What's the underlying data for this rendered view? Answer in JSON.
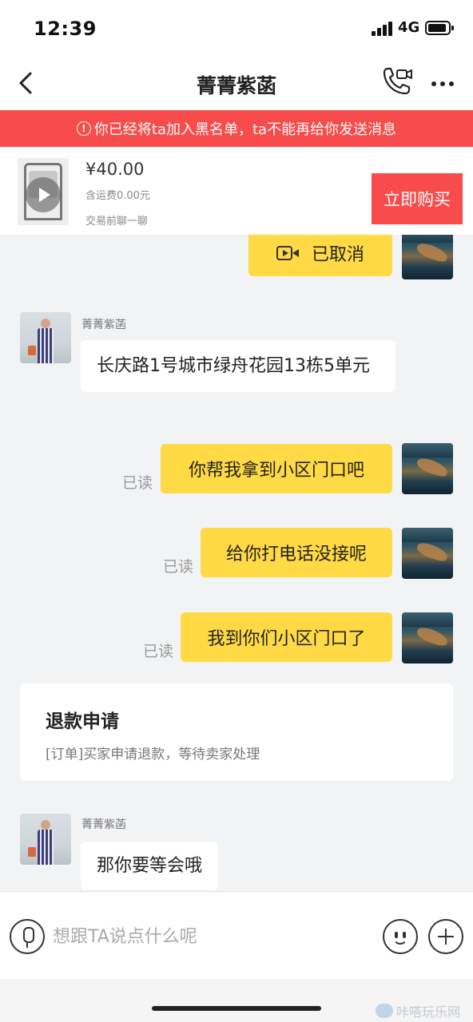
{
  "status_bar": {
    "time": "12:39",
    "network": "4G"
  },
  "nav": {
    "title": "菁菁紫菡"
  },
  "banner": {
    "warning_text": "你已经将ta加入黑名单，ta不能再给你发送消息"
  },
  "product": {
    "price": "¥40.00",
    "shipping": "含运费0.00元",
    "chat_tip": "交易前聊一聊",
    "buy_label": "立即购买"
  },
  "messages": [
    {
      "side": "right",
      "type": "video-call",
      "text": "已取消"
    },
    {
      "side": "left",
      "sender": "菁菁紫菡",
      "text": "长庆路1号城市绿舟花园13栋5单元"
    },
    {
      "side": "right",
      "status": "已读",
      "text": "你帮我拿到小区门口吧"
    },
    {
      "side": "right",
      "status": "已读",
      "text": "给你打电话没接呢"
    },
    {
      "side": "right",
      "status": "已读",
      "text": "我到你们小区门口了"
    },
    {
      "side": "left",
      "sender": "菁菁紫菡",
      "text": "那你要等会哦"
    }
  ],
  "refund_card": {
    "title": "退款申请",
    "description": "[订单]买家申请退款，等待卖家处理"
  },
  "input": {
    "placeholder": "想跟TA说点什么呢"
  },
  "watermark": "咔嗒玩乐网",
  "colors": {
    "accent_red": "#f84b4b",
    "bubble_yellow": "#ffda44",
    "background": "#f2f3f5"
  }
}
